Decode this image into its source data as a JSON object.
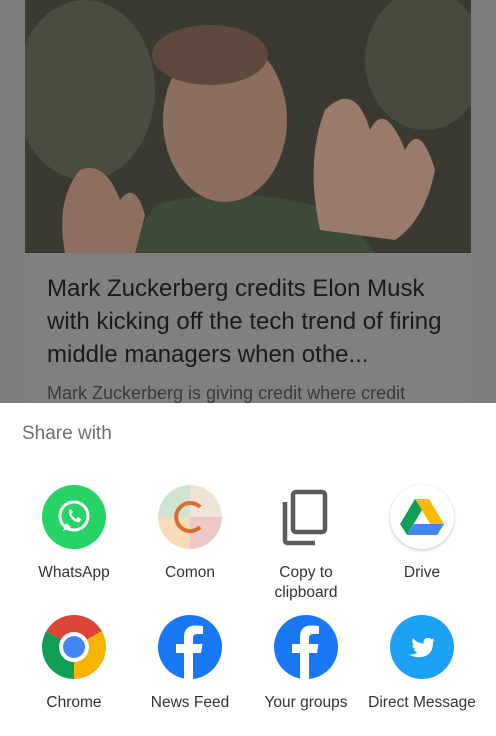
{
  "article": {
    "title": "Mark Zuckerberg credits Elon Musk with kicking off the tech trend of firing middle managers when othe...",
    "snippet": "Mark Zuckerberg is giving credit where credit"
  },
  "share_sheet": {
    "header": "Share with",
    "apps": [
      {
        "label": "WhatsApp",
        "icon": "whatsapp-icon",
        "color": "#25D366"
      },
      {
        "label": "Comon",
        "icon": "comon-icon",
        "color": "#D9783A"
      },
      {
        "label": "Copy to clipboard",
        "icon": "copy-icon",
        "color": "#555555"
      },
      {
        "label": "Drive",
        "icon": "drive-icon",
        "color": "#1FA463"
      },
      {
        "label": "Chrome",
        "icon": "chrome-icon",
        "color": "#4285F4"
      },
      {
        "label": "News Feed",
        "icon": "facebook-icon",
        "color": "#1877F2"
      },
      {
        "label": "Your groups",
        "icon": "facebook-icon",
        "color": "#1877F2"
      },
      {
        "label": "Direct Message",
        "icon": "twitter-icon",
        "color": "#1DA1F2"
      }
    ]
  }
}
